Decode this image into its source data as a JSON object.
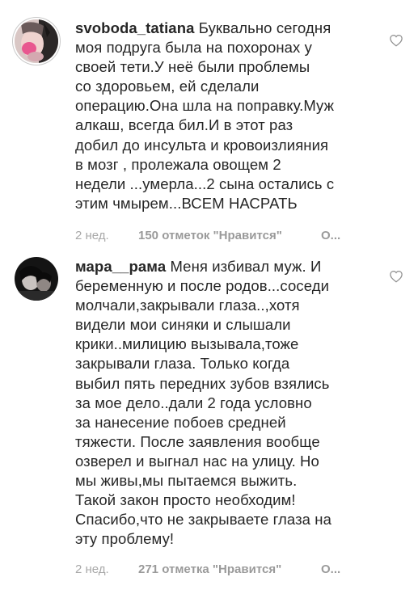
{
  "comments": [
    {
      "username": "svoboda_tatiana",
      "text": "Буквально сегодня\nмоя подруга была на похоронах у\nсвоей тети.У неё были проблемы\nсо здоровьем, ей сделали\nоперацию.Она шла на поправку.Муж\nалкаш, всегда бил.И в этот раз\nдобил до инсульта и кровоизлияния\nв мозг , пролежала овощем 2\nнедели ...умерла...2 сына остались с\nэтим чмырем...ВСЕМ НАСРАТЬ",
      "time": "2 нед.",
      "likes": "150 отметок \"Нравится\"",
      "reply": "О..."
    },
    {
      "username": "мара__рама",
      "text": "Меня избивал муж. И\nбеременную и после родов...соседи\nмолчали,закрывали глаза..,хотя\nвидели мои синяки и слышали\nкрики..милицию вызывала,тоже\nзакрывали глаза. Только когда\nвыбил пять передних зубов взялись\nза мое дело..дали 2 года условно\nза нанесение побоев средней\nтяжести. После заявления вообще\nозверел и выгнал нас на улицу. Но\nмы живы,мы пытаемся выжить.\nТакой закон просто необходим!\nСпасибо,что не закрываете глаза на\nэту проблему!",
      "time": "2 нед.",
      "likes": "271 отметка \"Нравится\"",
      "reply": "О..."
    }
  ]
}
